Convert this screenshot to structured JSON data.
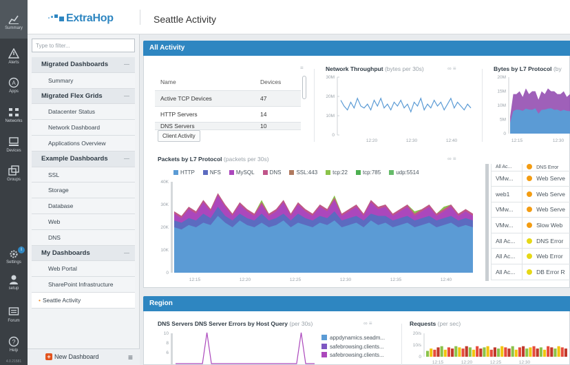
{
  "rail": {
    "items": [
      {
        "label": "Summary",
        "icon": "chart-icon"
      },
      {
        "label": "Alerts",
        "icon": "alert-icon"
      },
      {
        "label": "Apps",
        "icon": "apps-icon"
      },
      {
        "label": "Networks",
        "icon": "network-icon"
      },
      {
        "label": "Devices",
        "icon": "devices-icon"
      },
      {
        "label": "Groups",
        "icon": "groups-icon"
      },
      {
        "label": "Settings",
        "icon": "settings-icon"
      },
      {
        "label": "setup",
        "icon": "user-icon"
      },
      {
        "label": "Forum",
        "icon": "forum-icon"
      },
      {
        "label": "Help",
        "icon": "help-icon"
      }
    ],
    "settings_badge": "i",
    "version": "4.0.21581"
  },
  "brand": {
    "name": "ExtraHop",
    "color": "#2e86c1"
  },
  "header": {
    "title": "Seattle Activity"
  },
  "sidebar": {
    "filter_placeholder": "Type to filter...",
    "groups": [
      {
        "label": "Migrated Dashboards",
        "items": [
          "Summary"
        ]
      },
      {
        "label": "Migrated Flex Grids",
        "items": [
          "Datacenter Status",
          "Network Dashboard",
          "Applications Overview"
        ]
      },
      {
        "label": "Example Dashboards",
        "items": [
          "SSL",
          "Storage",
          "Database",
          "Web",
          "DNS"
        ]
      },
      {
        "label": "My Dashboards",
        "items": [
          "Web Portal",
          "SharePoint Infrastructure",
          "Seattle Activity"
        ]
      }
    ],
    "current": "Seattle Activity",
    "new_dashboard": "New Dashboard"
  },
  "sections": {
    "all_activity": "All Activity",
    "region": "Region"
  },
  "devices_table": {
    "headers": [
      "Name",
      "Devices"
    ],
    "rows": [
      [
        "Active TCP Devices",
        "47"
      ],
      [
        "HTTP Servers",
        "14"
      ],
      [
        "DNS Servers",
        "10"
      ]
    ],
    "button": "Client Activity"
  },
  "widgets": {
    "throughput": {
      "title": "Network Throughput",
      "sub": "(bytes per 30s)"
    },
    "bytes_l7": {
      "title": "Bytes by L7 Protocol",
      "sub": "(by"
    },
    "packets_l7": {
      "title": "Packets by L7 Protocol",
      "sub": "(packets per 30s)"
    },
    "dns_errors": {
      "title": "DNS Servers DNS Server Errors by Host Query",
      "sub": "(per 30s)"
    },
    "requests": {
      "title": "Requests",
      "sub": "(per sec)"
    }
  },
  "alerts": [
    {
      "source": "All Ac...",
      "type": "DNS Error",
      "color": "#f39c12"
    },
    {
      "source": "VMw...",
      "type": "Web Serve",
      "color": "#f39c12"
    },
    {
      "source": "web1",
      "type": "Web Serve",
      "color": "#f39c12"
    },
    {
      "source": "VMw...",
      "type": "Web Serve",
      "color": "#f39c12"
    },
    {
      "source": "VMw...",
      "type": "Slow Web",
      "color": "#f39c12"
    },
    {
      "source": "All Ac...",
      "type": "DNS Error",
      "color": "#e6d817"
    },
    {
      "source": "All Ac...",
      "type": "Web Error",
      "color": "#e6d817"
    },
    {
      "source": "All Ac...",
      "type": "DB Error R",
      "color": "#e6d817"
    }
  ],
  "dns_legend": [
    {
      "label": "appdynamics.seadm...",
      "color": "#5b9bd5"
    },
    {
      "label": "safebrowsing.clients...",
      "color": "#7e57c2"
    },
    {
      "label": "safebrowsing.clients...",
      "color": "#ab47bc"
    }
  ],
  "chart_data": [
    {
      "type": "line",
      "title": "Network Throughput",
      "subtitle": "(bytes per 30s)",
      "yticks": [
        "30M",
        "20M",
        "10M",
        "0"
      ],
      "xticks": [
        "12:20",
        "12:30",
        "12:40"
      ],
      "ylim": [
        0,
        30000000
      ],
      "series": [
        {
          "values": [
            18,
            15,
            13,
            17,
            14,
            19,
            15,
            14,
            16,
            13,
            18,
            15,
            19,
            14,
            16,
            13,
            17,
            15,
            18,
            14,
            16,
            12,
            17,
            15,
            19,
            13,
            16,
            14,
            18,
            15,
            17,
            13,
            16,
            19,
            14,
            17,
            15,
            13,
            16,
            14
          ]
        }
      ]
    },
    {
      "type": "area",
      "title": "Bytes by L7 Protocol",
      "yticks": [
        "20M",
        "15M",
        "10M",
        "5M",
        "0"
      ],
      "xticks": [
        "12:15",
        "12:30"
      ],
      "ylim": [
        0,
        20000000
      ],
      "series": [
        {
          "values": [
            4,
            11,
            10,
            12,
            9,
            13,
            10,
            12,
            11,
            9,
            12,
            10,
            13,
            11,
            12,
            10,
            11,
            12,
            9,
            11
          ]
        },
        {
          "values": [
            2,
            3,
            4,
            3,
            4,
            3,
            4,
            3,
            4,
            3,
            3,
            4,
            3,
            4,
            3,
            4,
            3,
            3,
            4,
            3
          ]
        }
      ]
    },
    {
      "type": "area",
      "title": "Packets by L7 Protocol",
      "subtitle": "(packets per 30s)",
      "legend": [
        "HTTP",
        "NFS",
        "MySQL",
        "DNS",
        "SSL:443",
        "tcp:22",
        "tcp:785",
        "udp:5514"
      ],
      "colors": [
        "#5b9bd5",
        "#5c6bc0",
        "#ab47bc",
        "#c0558a",
        "#b07a5f",
        "#8bc34a",
        "#4caf50",
        "#66bb6a"
      ],
      "yticks": [
        "40K",
        "30K",
        "20K",
        "10K",
        "0"
      ],
      "xticks": [
        "12:15",
        "12:20",
        "12:25",
        "12:30",
        "12:35",
        "12:40"
      ],
      "ylim": [
        0,
        40000
      ],
      "series": [
        {
          "name": "HTTP",
          "values": [
            20,
            19,
            21,
            20,
            22,
            21,
            25,
            22,
            20,
            23,
            21,
            20,
            22,
            20,
            21,
            23,
            20,
            22,
            21,
            20,
            22,
            21,
            23,
            20,
            21,
            22,
            20,
            23,
            21,
            22,
            20,
            21,
            22,
            20,
            21,
            22,
            20,
            21,
            22,
            20,
            21,
            20
          ]
        },
        {
          "name": "NFS",
          "values": [
            3,
            3,
            3,
            3,
            4,
            3,
            4,
            3,
            3,
            3,
            3,
            3,
            4,
            3,
            3,
            3,
            3,
            4,
            3,
            3,
            3,
            3,
            4,
            3,
            3,
            3,
            3,
            3,
            4,
            3,
            3,
            3,
            3,
            3,
            3,
            3,
            3,
            3,
            3,
            3,
            3,
            3
          ]
        },
        {
          "name": "MySQL",
          "values": [
            3,
            2,
            4,
            3,
            5,
            3,
            5,
            4,
            2,
            4,
            3,
            2,
            4,
            2,
            3,
            5,
            2,
            4,
            3,
            2,
            4,
            3,
            5,
            2,
            3,
            4,
            2,
            5,
            3,
            4,
            2,
            3,
            4,
            2,
            3,
            4,
            2,
            3,
            4,
            2,
            3,
            2
          ]
        },
        {
          "name": "DNS",
          "values": [
            1,
            1,
            1,
            1,
            1,
            1,
            1,
            1,
            1,
            1,
            1,
            1,
            1,
            1,
            1,
            1,
            1,
            1,
            1,
            1,
            1,
            1,
            1,
            1,
            1,
            1,
            1,
            1,
            1,
            1,
            1,
            1,
            1,
            1,
            1,
            1,
            1,
            1,
            1,
            1,
            1,
            1
          ]
        },
        {
          "name": "tcp:22",
          "values": [
            0,
            0,
            0,
            0,
            0,
            0,
            0,
            0,
            0,
            0,
            0,
            0,
            1,
            0,
            0,
            0,
            0,
            0,
            0,
            0,
            0,
            0,
            1,
            0,
            0,
            0,
            0,
            0,
            0,
            0,
            0,
            0,
            0,
            1,
            0,
            0,
            0,
            1,
            0,
            0,
            0,
            0
          ]
        }
      ]
    },
    {
      "type": "line",
      "title": "DNS Servers DNS Server Errors by Host Query",
      "subtitle": "(per 30s)",
      "yticks": [
        "10",
        "8",
        "6"
      ],
      "series": [
        {
          "values": [
            0,
            0,
            0,
            0,
            0,
            0,
            0,
            9,
            0,
            0,
            0,
            0,
            0,
            0,
            0,
            0,
            0,
            0,
            0,
            0,
            0,
            0,
            0,
            0,
            0,
            0,
            0,
            0,
            9,
            0,
            0,
            0
          ]
        }
      ]
    },
    {
      "type": "bar",
      "title": "Requests",
      "subtitle": "(per sec)",
      "yticks": [
        "20/s",
        "10/s",
        "0"
      ],
      "xticks": [
        "12:15",
        "12:20",
        "12:25",
        "12:30"
      ],
      "ylim": [
        0,
        20
      ],
      "series": [
        {
          "values": [
            5,
            7,
            6,
            8,
            9,
            6,
            8,
            7,
            9,
            8,
            7,
            9,
            8,
            6,
            9,
            7,
            8,
            9,
            6,
            8,
            7,
            9,
            8,
            7,
            9,
            6,
            8,
            9,
            7,
            8,
            9,
            7,
            8,
            6,
            9,
            8,
            7,
            9,
            8,
            7
          ]
        }
      ]
    }
  ]
}
